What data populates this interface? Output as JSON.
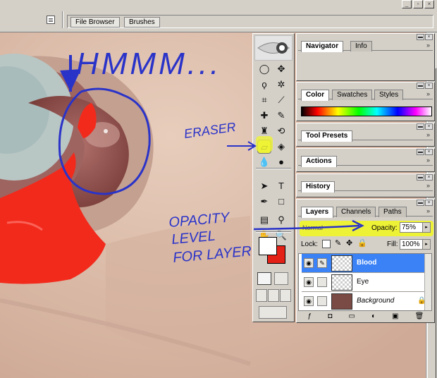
{
  "optionbar": {
    "tabs": [
      "File Browser",
      "Brushes"
    ]
  },
  "toolbox": {
    "tools": [
      {
        "name": "marquee-tool",
        "glyph": "◯"
      },
      {
        "name": "move-tool",
        "glyph": "✥"
      },
      {
        "name": "lasso-tool",
        "glyph": "ϙ"
      },
      {
        "name": "magic-wand-tool",
        "glyph": "✲"
      },
      {
        "name": "crop-tool",
        "glyph": "⌗"
      },
      {
        "name": "slice-tool",
        "glyph": "⟋"
      },
      {
        "name": "healing-brush-tool",
        "glyph": "✚"
      },
      {
        "name": "brush-tool",
        "glyph": "✎"
      },
      {
        "name": "clone-stamp-tool",
        "glyph": "♜"
      },
      {
        "name": "history-brush-tool",
        "glyph": "⟲"
      },
      {
        "name": "eraser-tool",
        "glyph": "▱"
      },
      {
        "name": "paint-bucket-tool",
        "glyph": "◈"
      },
      {
        "name": "blur-tool",
        "glyph": "💧"
      },
      {
        "name": "dodge-tool",
        "glyph": "●"
      },
      {
        "name": "path-selection-tool",
        "glyph": "➤"
      },
      {
        "name": "type-tool",
        "glyph": "T"
      },
      {
        "name": "pen-tool",
        "glyph": "✒"
      },
      {
        "name": "rectangle-tool",
        "glyph": "□"
      },
      {
        "name": "notes-tool",
        "glyph": "▤"
      },
      {
        "name": "eyedropper-tool",
        "glyph": "⚲"
      },
      {
        "name": "hand-tool",
        "glyph": "✋"
      },
      {
        "name": "zoom-tool",
        "glyph": "🔍"
      }
    ],
    "selected_tool": "eraser-tool",
    "foreground_color": "#ffffff",
    "background_color": "#e32117"
  },
  "palettes": {
    "navigator": {
      "tabs": [
        "Navigator",
        "Info"
      ]
    },
    "color": {
      "tabs": [
        "Color",
        "Swatches",
        "Styles"
      ]
    },
    "tool_presets": {
      "tabs": [
        "Tool Presets"
      ]
    },
    "actions": {
      "tabs": [
        "Actions"
      ]
    },
    "history": {
      "tabs": [
        "History"
      ]
    },
    "layers": {
      "tabs": [
        "Layers",
        "Channels",
        "Paths"
      ],
      "blend_mode": "Normal",
      "opacity_label": "Opacity:",
      "opacity_value": "75%",
      "lock_label": "Lock:",
      "fill_label": "Fill:",
      "fill_value": "100%",
      "layers": [
        {
          "name": "Blood",
          "selected": true,
          "visible": true
        },
        {
          "name": "Eye",
          "selected": false,
          "visible": true
        },
        {
          "name": "Background",
          "selected": false,
          "visible": true,
          "locked": true
        }
      ]
    }
  },
  "annotations": {
    "hmmm": "HMMM...",
    "eraser": "ERASER",
    "opacity_note": [
      "OPACITY",
      "LEVEL",
      "FOR LAYER"
    ]
  },
  "colors": {
    "annotation_blue": "#2a33c8",
    "highlight_yellow": "#eef236",
    "blood_red": "#f22a1c"
  }
}
